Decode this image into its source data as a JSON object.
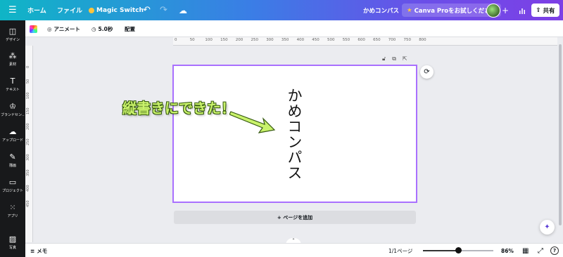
{
  "topbar": {
    "menu_icon": "hamburger-icon",
    "home": "ホーム",
    "file": "ファイル",
    "magic_switch": "Magic Switch",
    "doc_title": "かめコンパス",
    "pro_button": "Canva Proをお試しください",
    "share": "共有"
  },
  "sidebar": {
    "items": [
      {
        "label": "デザイン",
        "icon": "layout-icon"
      },
      {
        "label": "素材",
        "icon": "elements-icon"
      },
      {
        "label": "テキスト",
        "icon": "text-icon"
      },
      {
        "label": "ブランドセン…",
        "icon": "brand-icon"
      },
      {
        "label": "アップロード",
        "icon": "upload-icon"
      },
      {
        "label": "描画",
        "icon": "draw-icon"
      },
      {
        "label": "プロジェクト",
        "icon": "folder-icon"
      },
      {
        "label": "アプリ",
        "icon": "apps-icon"
      },
      {
        "label": "写真",
        "icon": "photo-icon"
      }
    ]
  },
  "toolbar": {
    "animate": "アニメート",
    "duration": "5.0秒",
    "position": "配置"
  },
  "ruler": {
    "top": [
      "0",
      "50",
      "100",
      "150",
      "200",
      "250",
      "300",
      "350",
      "400",
      "450",
      "500",
      "550",
      "600",
      "650",
      "700",
      "750",
      "800"
    ],
    "left": [
      "0",
      "50",
      "100",
      "150",
      "200",
      "250",
      "300",
      "350",
      "400",
      "450"
    ]
  },
  "canvas": {
    "vertical_text": "かめコンパス",
    "annotation": "縦書きにできた！",
    "add_page": "+ ページを追加"
  },
  "bottombar": {
    "memo": "メモ",
    "page_count": "1/1ページ",
    "zoom": "86%",
    "zoom_level": 0.5
  },
  "colors": {
    "selection": "#a970ff",
    "annotation_fill": "#c9f26b",
    "annotation_stroke": "#365a10"
  }
}
